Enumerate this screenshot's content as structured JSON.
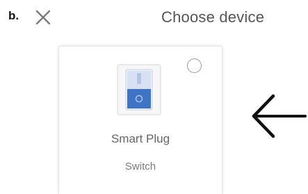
{
  "figure": {
    "step_label": "b."
  },
  "header": {
    "title": "Choose device",
    "close_icon": "close-icon"
  },
  "device_card": {
    "name": "Smart Plug",
    "type": "Switch",
    "icon": "switch-icon",
    "selected": false
  },
  "annotation": {
    "arrow_icon": "arrow-left-icon"
  },
  "colors": {
    "switch_blue": "#3f73c4",
    "switch_light": "#cfdaf0",
    "text_gray": "#666666",
    "arrow": "#111111"
  }
}
